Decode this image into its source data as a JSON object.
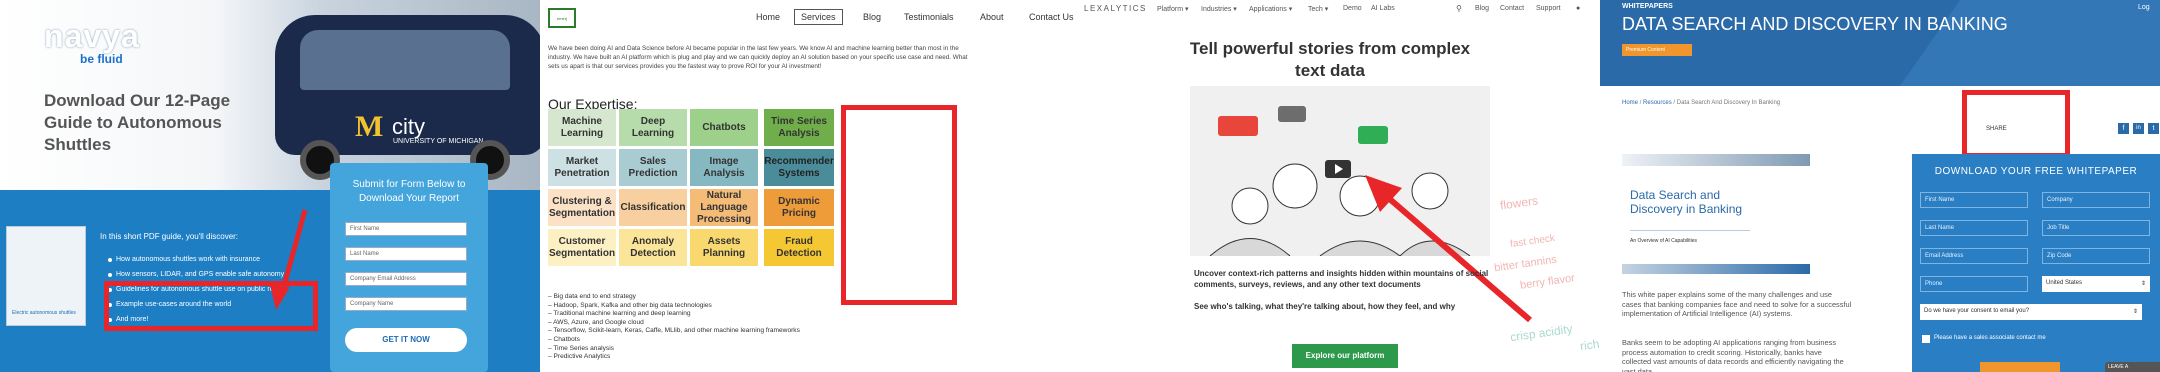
{
  "panel1": {
    "logo_name": "navya",
    "logo_tagline": "be fluid",
    "title": "Download Our 12-Page Guide to Autonomous Shuttles",
    "bus_letter": "M",
    "bus_text": "city",
    "bus_sub": "UNIVERSITY OF MICHIGAN",
    "book_title": "Electric autonomous shuttles",
    "intro": "In this short PDF guide, you'll discover:",
    "list": [
      "How autonomous shuttles work with insurance",
      "How sensors, LIDAR, and GPS enable safe autonomy",
      "Guidelines for autonomous shuttle use on public roads",
      "Example use-cases around the world",
      "And more!"
    ],
    "form_heading": "Submit for Form Below to Download Your Report",
    "fields": [
      "First Name",
      "Last Name",
      "Company Email Address",
      "Company Name"
    ],
    "button": "GET IT NOW"
  },
  "panel2": {
    "logo": "emerj",
    "nav": [
      "Home",
      "Services",
      "Blog",
      "Testimonials",
      "About",
      "Contact Us"
    ],
    "nav_selected": "Services",
    "intro": "We have been doing AI and Data Science before AI became popular in the last few years. We know AI and machine learning better than most in the industry. We have built an AI platform which is plug and play and we can quickly deploy an AI solution based on your specific use case and need. What sets us apart is that our services provides you the fastest way to prove ROI for your AI investment!",
    "expertise_heading": "Our Expertise:",
    "grid": [
      [
        "Machine Learning",
        "Deep Learning",
        "Chatbots",
        "Time Series Analysis"
      ],
      [
        "Market Penetration",
        "Sales Prediction",
        "Image Analysis",
        "Recommender Systems"
      ],
      [
        "Clustering & Segmentation",
        "Classification",
        "Natural Language Processing",
        "Dynamic Pricing"
      ],
      [
        "Customer Segmentation",
        "Anomaly Detection",
        "Assets Planning",
        "Fraud Detection"
      ]
    ],
    "grid_colors": [
      [
        "#d5e8cf",
        "#b7dcab",
        "#9dd08a",
        "#6fae4a"
      ],
      [
        "#cde0e4",
        "#a9ccd3",
        "#86b8c2",
        "#4a8c99"
      ],
      [
        "#fbe1c6",
        "#f8cf9f",
        "#f5bc78",
        "#ee9b3a"
      ],
      [
        "#fdf1c4",
        "#fbe598",
        "#f9d96d",
        "#f5c732"
      ]
    ],
    "bullets": [
      "– Big data end to end strategy",
      "– Hadoop, Spark, Kafka and other big data technologies",
      "– Traditional machine learning and deep learning",
      "– AWS, Azure, and Google cloud",
      "– Tensorflow, Scikit-learn, Keras, Caffe, MLlib, and other machine learning frameworks",
      "– Chatbots",
      "– Time Series analysis",
      "– Predictive Analytics"
    ]
  },
  "panel3": {
    "logo": "LEXALYTICS",
    "nav": [
      "Platform ▾",
      "Industries ▾",
      "Applications ▾",
      "Tech ▾",
      "Demo",
      "AI Labs"
    ],
    "nav_right": [
      "Blog",
      "Contact",
      "Support"
    ],
    "heading": "Tell powerful stories from complex text data",
    "text1": "Uncover context-rich patterns and insights hidden within mountains of social comments, surveys, reviews, and any other text documents",
    "text2": "See who's talking, what they're talking about, how they feel, and why",
    "button": "Explore our platform",
    "side_words": [
      "flowers",
      "fast check",
      "bitter tannins",
      "berry flavor",
      "crisp acidity",
      "rich"
    ]
  },
  "panel4": {
    "login": "Log",
    "label": "WHITEPAPERS",
    "title": "DATA SEARCH AND DISCOVERY IN BANKING",
    "badge": "Premium Content",
    "breadcrumb": [
      "Home",
      "Resources",
      "Data Search And Discovery In Banking"
    ],
    "share": "SHARE",
    "social": [
      "f",
      "in",
      "t"
    ],
    "cover_title": "Data Search and Discovery in Banking",
    "cover_sub": "An Overview of AI Capabilities",
    "para1": "This white paper explains some of the many challenges and use cases that banking companies face and need to solve for a successful implementation of Artificial Intelligence (AI) systems.",
    "para2": "Banks seem to be adopting AI applications ranging from business process automation to credit scoring. Historically, banks have collected vast amounts of data records and efficiently navigating the vast data",
    "form_heading": "DOWNLOAD YOUR FREE WHITEPAPER",
    "fields_left": [
      "First Name",
      "Last Name",
      "Email Address",
      "Phone"
    ],
    "fields_right": [
      "Company",
      "Job Title",
      "Zip Code"
    ],
    "country": "United States",
    "consent": "Do we have your consent to email you?",
    "checkbox_label": "Please have a sales associate contact me",
    "leave": "LEAVE A"
  }
}
